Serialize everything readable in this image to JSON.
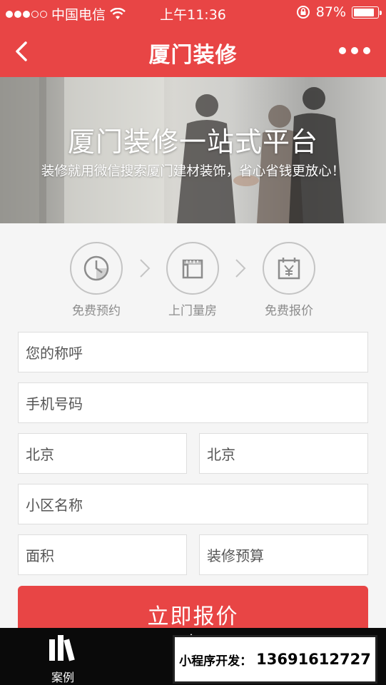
{
  "status_bar": {
    "carrier": "中国电信",
    "time": "上午11:36",
    "battery": "87%",
    "battery_level": 0.87
  },
  "nav": {
    "title": "厦门装修"
  },
  "banner": {
    "title": "厦门装修一站式平台",
    "subtitle": "装修就用微信搜索厦门建材装饰，省心省钱更放心！"
  },
  "steps": [
    {
      "label": "免费预约",
      "icon": "clock-icon"
    },
    {
      "label": "上门量房",
      "icon": "ruler-frame-icon"
    },
    {
      "label": "免费报价",
      "icon": "calendar-yen-icon"
    }
  ],
  "form": {
    "name_placeholder": "您的称呼",
    "phone_placeholder": "手机号码",
    "province": "北京",
    "city": "北京",
    "community_placeholder": "小区名称",
    "area_placeholder": "面积",
    "budget_placeholder": "装修预算",
    "submit_label": "立即报价"
  },
  "tabbar": {
    "case_label": "案例"
  },
  "promo": {
    "label": "小程序开发：",
    "phone": "13691612727"
  },
  "colors": {
    "brand": "#e84545",
    "tabbar": "#0a0a0a"
  }
}
